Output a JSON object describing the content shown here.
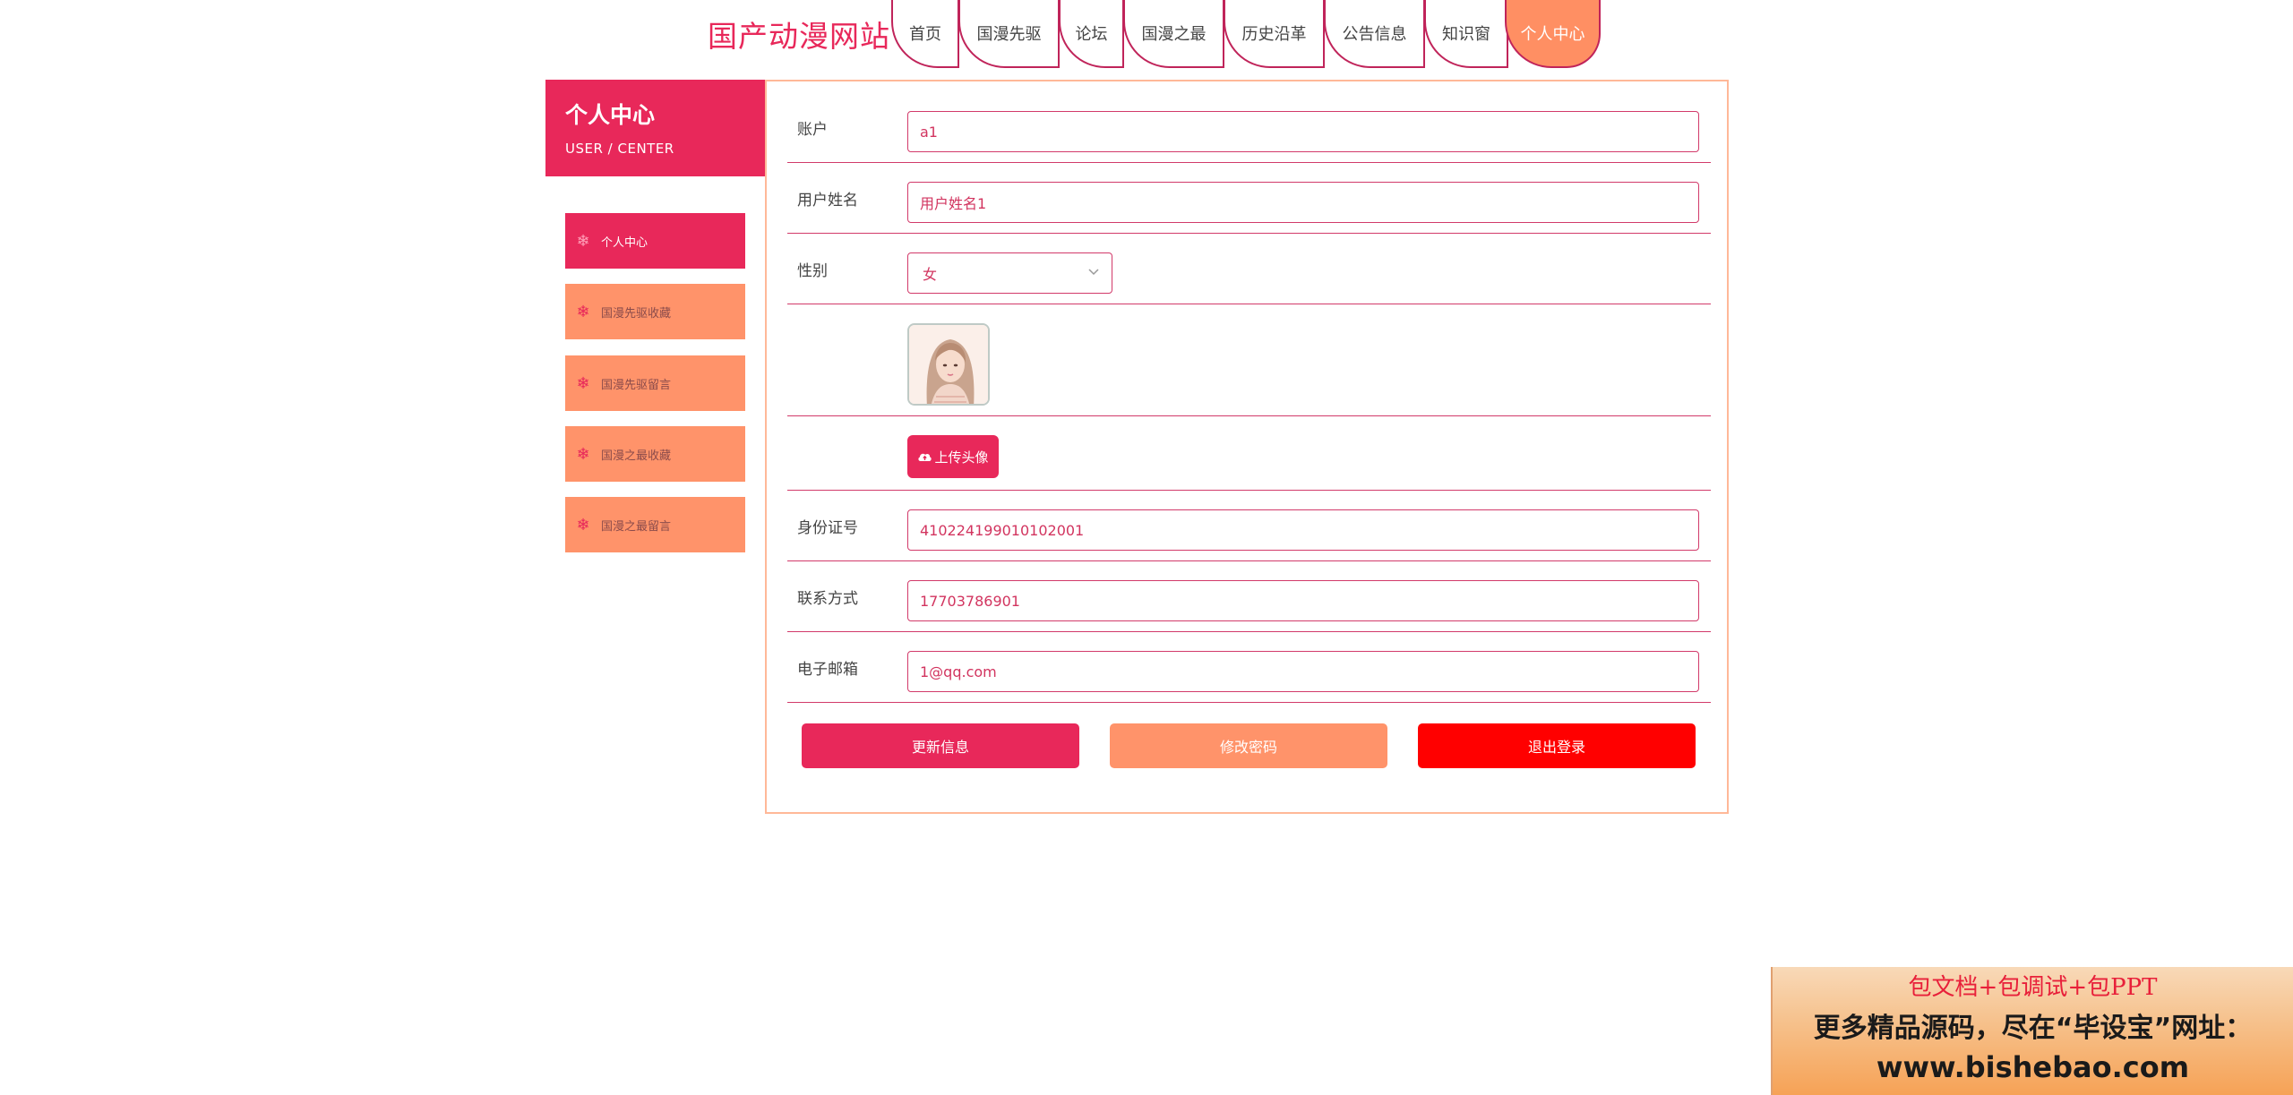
{
  "site": {
    "title": "国产动漫网站"
  },
  "nav": {
    "items": [
      {
        "label": "首页"
      },
      {
        "label": "国漫先驱"
      },
      {
        "label": "论坛"
      },
      {
        "label": "国漫之最"
      },
      {
        "label": "历史沿革"
      },
      {
        "label": "公告信息"
      },
      {
        "label": "知识窗"
      },
      {
        "label": "个人中心"
      }
    ],
    "active": "个人中心"
  },
  "sidebar": {
    "title": "个人中心",
    "subtitle": "USER / CENTER",
    "items": [
      {
        "label": "个人中心",
        "active": true
      },
      {
        "label": "国漫先驱收藏"
      },
      {
        "label": "国漫先驱留言"
      },
      {
        "label": "国漫之最收藏"
      },
      {
        "label": "国漫之最留言"
      }
    ],
    "icon": "snowflake-icon"
  },
  "form": {
    "account": {
      "label": "账户",
      "value": "a1"
    },
    "username": {
      "label": "用户姓名",
      "value": "用户姓名1"
    },
    "gender": {
      "label": "性别",
      "value": "女"
    },
    "avatar": {
      "icon": "avatar-image"
    },
    "upload": {
      "label": "上传头像",
      "icon": "cloud-upload-icon"
    },
    "id_number": {
      "label": "身份证号",
      "value": "410224199010102001"
    },
    "phone": {
      "label": "联系方式",
      "value": "17703786901"
    },
    "email": {
      "label": "电子邮箱",
      "value": "1@qq.com"
    }
  },
  "actions": {
    "update": "更新信息",
    "change_password": "修改密码",
    "logout": "退出登录"
  },
  "banner": {
    "line1": "包文档+包调试+包PPT",
    "line2": "更多精品源码，尽在“毕设宝”网址：",
    "line3": "www.bishebao.com"
  },
  "colors": {
    "primary": "#e8285a",
    "secondary": "#ff936a",
    "danger": "#ff0000",
    "panel_border": "#ffb898"
  }
}
